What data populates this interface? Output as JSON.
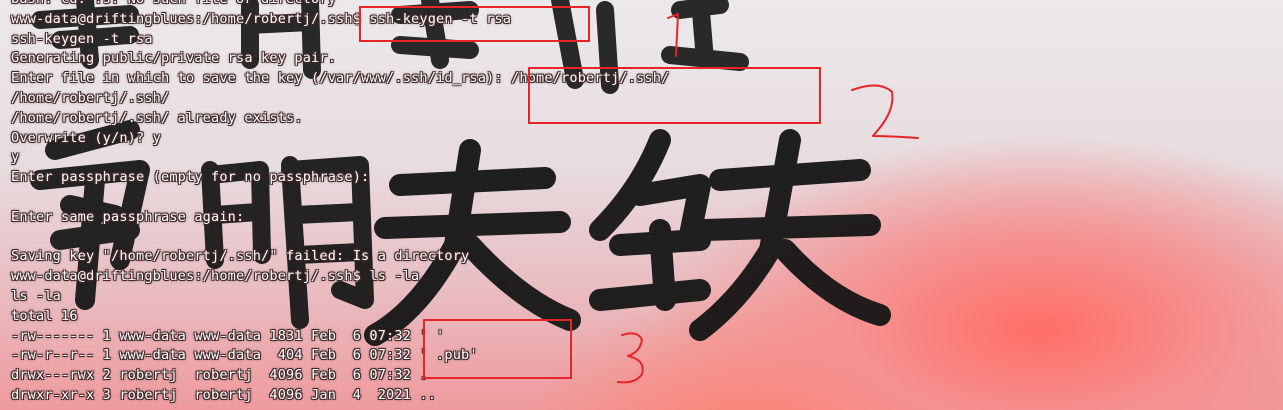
{
  "terminal": {
    "lines": [
      "bash: cd: .s: No such file or directory",
      "www-data@driftingblues:/home/robertj/.ssh$ ssh-keygen -t rsa",
      "ssh-keygen -t rsa",
      "Generating public/private rsa key pair.",
      "Enter file in which to save the key (/var/www/.ssh/id_rsa): /home/robertj/.ssh/",
      "/home/robertj/.ssh/",
      "/home/robertj/.ssh/ already exists.",
      "Overwrite (y/n)? y",
      "y",
      "Enter passphrase (empty for no passphrase):",
      "",
      "Enter same passphrase again:",
      "",
      "Saving key \"/home/robertj/.ssh/\" failed: Is a directory",
      "www-data@driftingblues:/home/robertj/.ssh$ ls -la",
      "ls -la",
      "total 16",
      "-rw------- 1 www-data www-data 1831 Feb  6 07:32 ' '",
      "-rw-r--r-- 1 www-data www-data  404 Feb  6 07:32 ' .pub'",
      "drwx---rwx 2 robertj  robertj  4096 Feb  6 07:32 .",
      "drwxr-xr-x 3 robertj  robertj  4096 Jan  4  2021 .."
    ]
  },
  "annotations": {
    "color": "#e8242a",
    "marks": [
      "1",
      "2",
      "3"
    ]
  },
  "wallpaper": {
    "calligraphy_chars": [
      "铁",
      "骨",
      "明",
      "天",
      "铁"
    ]
  }
}
